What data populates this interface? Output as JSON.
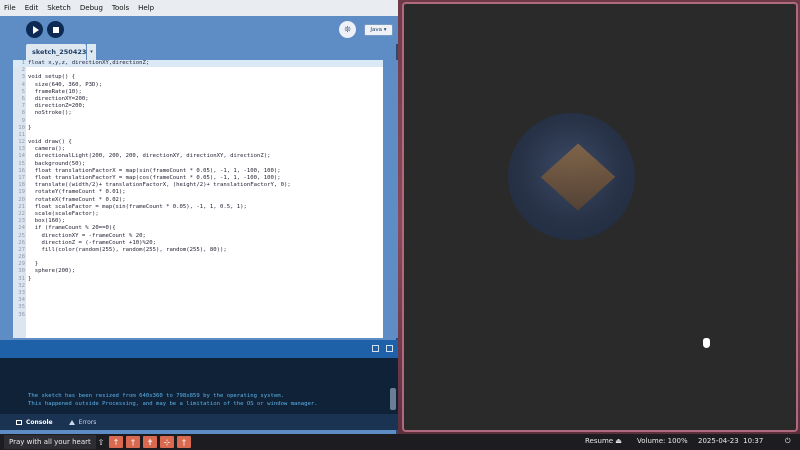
{
  "ide": {
    "menu": [
      "File",
      "Edit",
      "Sketch",
      "Debug",
      "Tools",
      "Help"
    ],
    "tab_name": "sketch_250423a",
    "tab_menu": "▾",
    "mode": "Java ▾",
    "run_icon": "play-icon",
    "stop_icon": "stop-icon",
    "debug_icon": "butterfly-icon",
    "code": [
      {
        "n": "1",
        "t": "float x,y,z, directionXY,directionZ;"
      },
      {
        "n": "2",
        "t": ""
      },
      {
        "n": "3",
        "t": "void setup() {"
      },
      {
        "n": "4",
        "t": "  size(640, 360, P3D);"
      },
      {
        "n": "5",
        "t": "  frameRate(10);"
      },
      {
        "n": "6",
        "t": "  directionXY=200;"
      },
      {
        "n": "7",
        "t": "  directionZ=200;"
      },
      {
        "n": "8",
        "t": "  noStroke();"
      },
      {
        "n": "9",
        "t": ""
      },
      {
        "n": "10",
        "t": "}"
      },
      {
        "n": "11",
        "t": ""
      },
      {
        "n": "12",
        "t": "void draw() {"
      },
      {
        "n": "13",
        "t": "  camera();"
      },
      {
        "n": "14",
        "t": "  directionalLight(200, 200, 200, directionXY, directionXY, directionZ);"
      },
      {
        "n": "15",
        "t": "  background(50);"
      },
      {
        "n": "16",
        "t": "  float translationFactorX = map(sin(frameCount * 0.05), -1, 1, -100, 100);"
      },
      {
        "n": "17",
        "t": "  float translationFactorY = map(cos(frameCount * 0.05), -1, 1, -100, 100);"
      },
      {
        "n": "18",
        "t": "  translate((width/2)+ translationFactorX, (height/2)+ translationFactorY, 0);"
      },
      {
        "n": "19",
        "t": "  rotateY(frameCount * 0.01);"
      },
      {
        "n": "20",
        "t": "  rotateX(frameCount * 0.02);"
      },
      {
        "n": "21",
        "t": "  float scaleFactor = map(sin(frameCount * 0.05), -1, 1, 0.5, 1);"
      },
      {
        "n": "22",
        "t": "  scale(scaleFactor);"
      },
      {
        "n": "23",
        "t": "  box(160);"
      },
      {
        "n": "24",
        "t": "  if (frameCount % 20==0){"
      },
      {
        "n": "25",
        "t": "    directionXY = -frameCount % 20;"
      },
      {
        "n": "26",
        "t": "    directionZ = (-frameCount +10)%20;"
      },
      {
        "n": "27",
        "t": "    fill(color(random(255), random(255), random(255), 80));"
      },
      {
        "n": "28",
        "t": ""
      },
      {
        "n": "29",
        "t": "  }"
      },
      {
        "n": "30",
        "t": "  sphere(200);"
      },
      {
        "n": "31",
        "t": "}"
      },
      {
        "n": "32",
        "t": ""
      },
      {
        "n": "33",
        "t": ""
      },
      {
        "n": "34",
        "t": ""
      },
      {
        "n": "35",
        "t": ""
      },
      {
        "n": "36",
        "t": ""
      }
    ],
    "console_message": "The sketch has been resized from 640x360 to 798x859 by the operating system.\nThis happened outside Processing, and may be a limitation of the OS or window manager.",
    "console_tab": "Console",
    "errors_tab": "Errors"
  },
  "taskbar": {
    "window_title": "Pray with all your heart",
    "icons": [
      "⇧",
      "↑",
      "†",
      "✝",
      "⊹",
      "†"
    ],
    "resume": "Resume ⏏",
    "volume": "Volume: 100%",
    "datetime": "2025-04-23  10:37",
    "power_icon": "⏻"
  }
}
